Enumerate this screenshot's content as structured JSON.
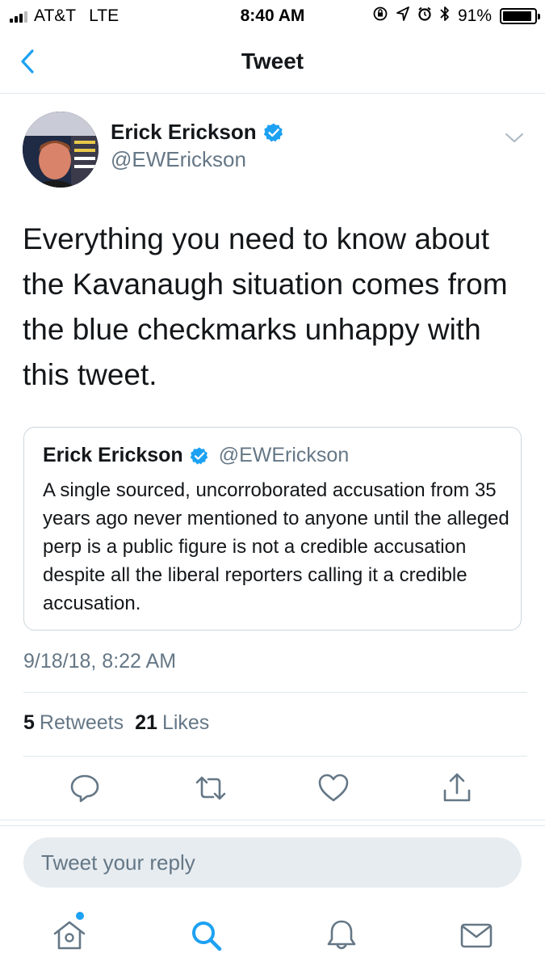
{
  "status_bar": {
    "carrier": "AT&T",
    "network": "LTE",
    "time": "8:40 AM",
    "battery_percent": "91%",
    "battery_level": 0.91,
    "icons": [
      "orientation-lock-icon",
      "location-icon",
      "alarm-icon",
      "bluetooth-icon"
    ]
  },
  "nav": {
    "title": "Tweet",
    "back_icon": "chevron-left-icon"
  },
  "tweet": {
    "author_name": "Erick Erickson",
    "author_handle": "@EWErickson",
    "verified": true,
    "text": "Everything you need to know about the Kavanaugh situation comes from the blue checkmarks unhappy with this tweet.",
    "timestamp": "9/18/18, 8:22 AM",
    "retweets_count": "5",
    "retweets_label": "Retweets",
    "likes_count": "21",
    "likes_label": "Likes"
  },
  "quoted_tweet": {
    "author_name": "Erick Erickson",
    "author_handle": "@EWErickson",
    "verified": true,
    "text": "A single sourced, uncorroborated accusation from 35 years ago never mentioned to anyone until the alleged perp is a public figure is not a credible accusation despite all the liberal reporters calling it a credible accusation."
  },
  "actions": [
    "reply-icon",
    "retweet-icon",
    "like-icon",
    "share-icon"
  ],
  "reply": {
    "placeholder": "Tweet your reply"
  },
  "tab_bar": {
    "items": [
      "home-icon",
      "search-icon",
      "notifications-icon",
      "messages-icon"
    ]
  },
  "colors": {
    "accent": "#1da1f2",
    "text_primary": "#14171a",
    "text_secondary": "#657786",
    "divider": "#e1e8ed"
  }
}
